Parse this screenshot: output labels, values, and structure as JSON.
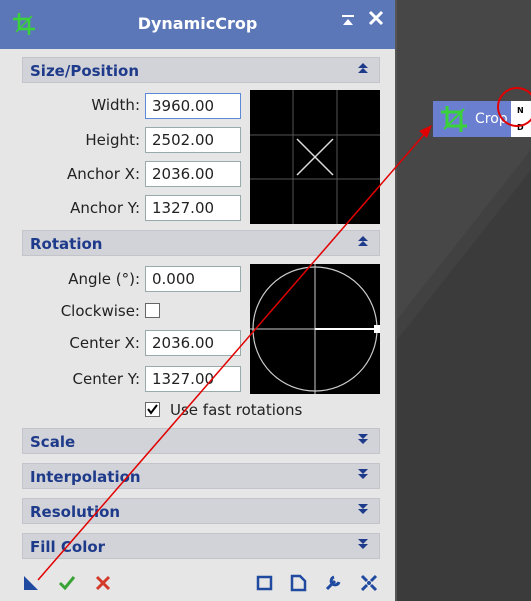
{
  "window": {
    "title": "DynamicCrop",
    "shade_glyph": "⬍",
    "close_glyph": "✕"
  },
  "sections": {
    "size_position": {
      "label": "Size/Position",
      "state": "expanded"
    },
    "rotation": {
      "label": "Rotation",
      "state": "expanded"
    },
    "scale": {
      "label": "Scale",
      "state": "collapsed"
    },
    "interpolation": {
      "label": "Interpolation",
      "state": "collapsed"
    },
    "resolution": {
      "label": "Resolution",
      "state": "collapsed"
    },
    "fill_color": {
      "label": "Fill Color",
      "state": "collapsed"
    }
  },
  "size_position": {
    "width_label": "Width:",
    "width_value": "3960.00",
    "height_label": "Height:",
    "height_value": "2502.00",
    "anchor_x_label": "Anchor X:",
    "anchor_x_value": "2036.00",
    "anchor_y_label": "Anchor Y:",
    "anchor_y_value": "1327.00"
  },
  "rotation": {
    "angle_label": "Angle (°):",
    "angle_value": "0.000",
    "clockwise_label": "Clockwise:",
    "clockwise_checked": false,
    "center_x_label": "Center X:",
    "center_x_value": "2036.00",
    "center_y_label": "Center Y:",
    "center_y_value": "1327.00",
    "fast_rotations_label": "Use fast rotations",
    "fast_rotations_checked": true
  },
  "process_icon": {
    "label": "Crop",
    "marker_top": "N",
    "marker_bottom": "D"
  },
  "colors": {
    "titlebar": "#5b77b8",
    "section_text": "#1e3a8a",
    "annotation_red": "#e10000",
    "apply_green": "#3aa335",
    "cancel_red": "#d23a2a",
    "icon_blue": "#1f4aa0"
  }
}
